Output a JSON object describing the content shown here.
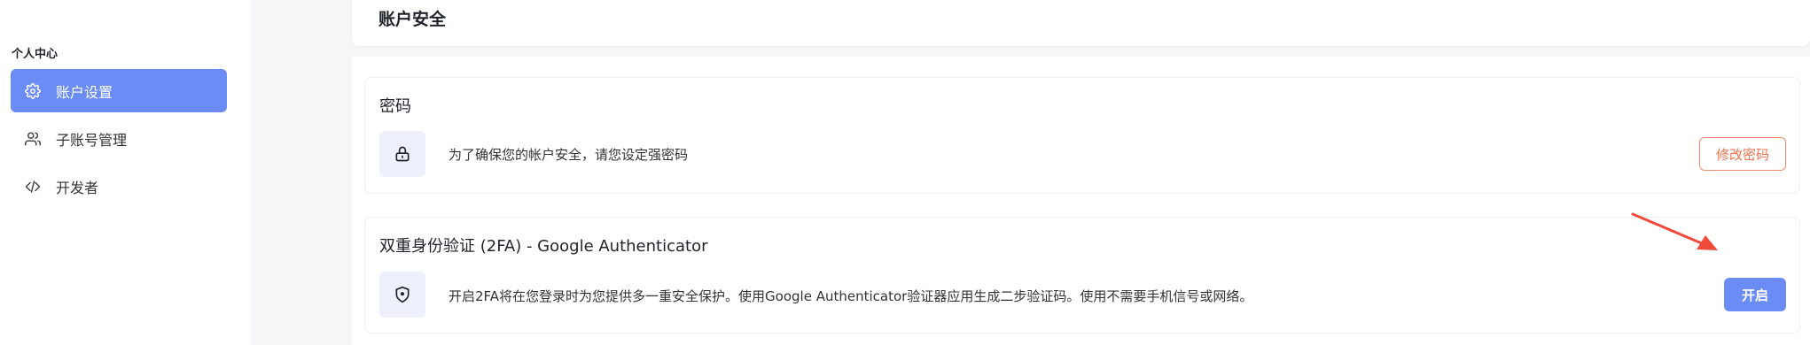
{
  "sidebar": {
    "section_title": "个人中心",
    "items": [
      {
        "label": "账户设置",
        "icon": "gear-icon",
        "active": true
      },
      {
        "label": "子账号管理",
        "icon": "users-icon",
        "active": false
      },
      {
        "label": "开发者",
        "icon": "code-icon",
        "active": false
      }
    ]
  },
  "header": {
    "title": "账户安全"
  },
  "password": {
    "title": "密码",
    "icon": "lock-icon",
    "description": "为了确保您的帐户安全，请您设定强密码",
    "button_label": "修改密码"
  },
  "two_factor": {
    "title": "双重身份验证 (2FA) - Google Authenticator",
    "icon": "shield-icon",
    "description": "开启2FA将在您登录时为您提供多一重安全保护。使用Google Authenticator验证器应用生成二步验证码。使用不需要手机信号或网络。",
    "button_label": "开启"
  },
  "colors": {
    "accent": "#6b8cf5",
    "danger_outline": "#f0714f",
    "annotation_arrow": "#f04a3c"
  }
}
